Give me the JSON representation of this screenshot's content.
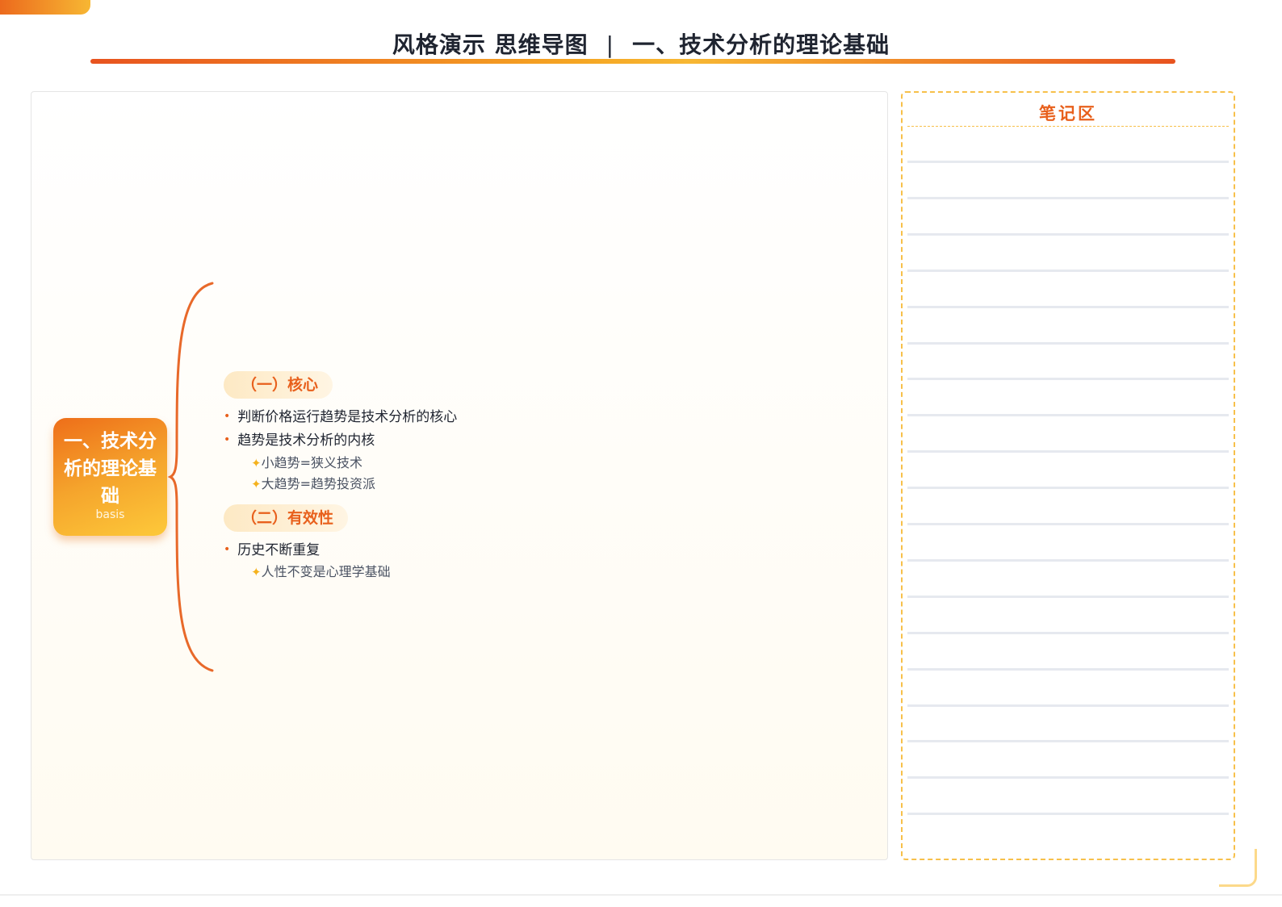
{
  "header": {
    "title_left": "风格演示 思维导图",
    "separator": "|",
    "title_right": "一、技术分析的理论基础"
  },
  "mindmap": {
    "root": {
      "title": "一、技术分析的理论基础",
      "subtitle": "basis"
    },
    "branches": [
      {
        "label": "（一）核心",
        "bullets": [
          {
            "text": "判断价格运行趋势是技术分析的核心",
            "children": []
          },
          {
            "text": "趋势是技术分析的内核",
            "children": [
              "小趋势=狭义技术",
              "大趋势=趋势投资派"
            ]
          }
        ]
      },
      {
        "label": "（二）有效性",
        "bullets": [
          {
            "text": "历史不断重复",
            "children": [
              "人性不变是心理学基础"
            ]
          }
        ]
      }
    ]
  },
  "notes": {
    "title": "笔记区"
  },
  "colors": {
    "accent": "#e8601c",
    "gold": "#f7b733",
    "brace": "#e8692a"
  }
}
